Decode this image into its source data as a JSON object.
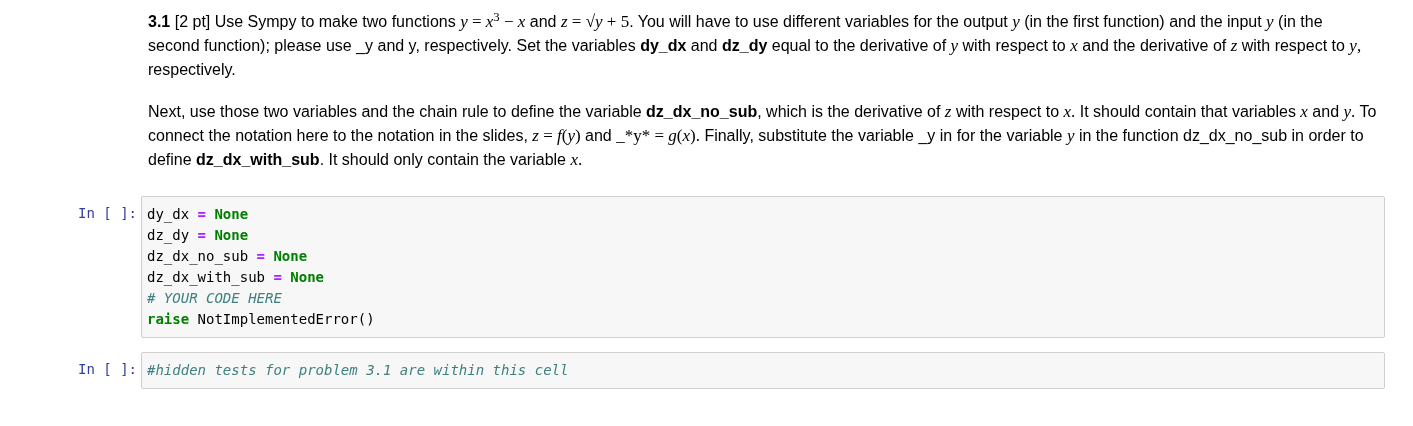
{
  "markdown_cell": {
    "paragraphs": [
      [
        {
          "kind": "bold",
          "text": "3.1"
        },
        {
          "kind": "text",
          "text": " [2 pt] Use Sympy to make two functions "
        },
        {
          "kind": "math",
          "text": "*y* = *x*$^{3}$ − *x*"
        },
        {
          "kind": "text",
          "text": " and "
        },
        {
          "kind": "math",
          "text": "*z* = √*y* + 5"
        },
        {
          "kind": "text",
          "text": ". You will have to use different variables for the output "
        },
        {
          "kind": "math",
          "text": "*y*"
        },
        {
          "kind": "text",
          "text": " (in the first function) and the input "
        },
        {
          "kind": "math",
          "text": "*y*"
        },
        {
          "kind": "text",
          "text": " (in the second function); please use _y and y, respectively. Set the variables "
        },
        {
          "kind": "bold",
          "text": "dy_dx"
        },
        {
          "kind": "text",
          "text": " and "
        },
        {
          "kind": "bold",
          "text": "dz_dy"
        },
        {
          "kind": "text",
          "text": " equal to the derivative of "
        },
        {
          "kind": "math",
          "text": "*y*"
        },
        {
          "kind": "text",
          "text": " with respect to "
        },
        {
          "kind": "math",
          "text": "*x*"
        },
        {
          "kind": "text",
          "text": " and the derivative of "
        },
        {
          "kind": "math",
          "text": "*z*"
        },
        {
          "kind": "text",
          "text": " with respect to "
        },
        {
          "kind": "math",
          "text": "*y*,"
        },
        {
          "kind": "text",
          "text": " respectively."
        }
      ],
      [
        {
          "kind": "text",
          "text": "Next, use those two variables and the chain rule to define the variable "
        },
        {
          "kind": "bold",
          "text": "dz_dx_no_sub"
        },
        {
          "kind": "text",
          "text": ", which is the derivative of "
        },
        {
          "kind": "math",
          "text": "*z*"
        },
        {
          "kind": "text",
          "text": " with respect to "
        },
        {
          "kind": "math",
          "text": "*x*."
        },
        {
          "kind": "text",
          "text": " It should contain that variables "
        },
        {
          "kind": "math",
          "text": "*x*"
        },
        {
          "kind": "text",
          "text": " and "
        },
        {
          "kind": "math",
          "text": "*y*."
        },
        {
          "kind": "text",
          "text": " To connect the notation here to the notation in the slides, "
        },
        {
          "kind": "math",
          "text": "*z* = *f*(*y*)"
        },
        {
          "kind": "text",
          "text": " and "
        },
        {
          "kind": "math",
          "text": "_*y* = *g*(*x*)."
        },
        {
          "kind": "text",
          "text": " Finally, substitute the variable _y in for the variable "
        },
        {
          "kind": "math",
          "text": "*y*"
        },
        {
          "kind": "text",
          "text": " in the function dz_dx_no_sub in order to define "
        },
        {
          "kind": "bold",
          "text": "dz_dx_with_sub"
        },
        {
          "kind": "text",
          "text": ". It should only contain the variable "
        },
        {
          "kind": "math",
          "text": "*x*."
        }
      ]
    ]
  },
  "code_cells": [
    {
      "prompt": "In [ ]:",
      "lines": [
        [
          {
            "kind": "name",
            "text": "dy_dx "
          },
          {
            "kind": "op",
            "text": "="
          },
          {
            "kind": "const",
            "text": " None"
          }
        ],
        [
          {
            "kind": "name",
            "text": "dz_dy "
          },
          {
            "kind": "op",
            "text": "="
          },
          {
            "kind": "const",
            "text": " None"
          }
        ],
        [
          {
            "kind": "name",
            "text": "dz_dx_no_sub "
          },
          {
            "kind": "op",
            "text": "="
          },
          {
            "kind": "const",
            "text": " None"
          }
        ],
        [
          {
            "kind": "name",
            "text": "dz_dx_with_sub "
          },
          {
            "kind": "op",
            "text": "="
          },
          {
            "kind": "const",
            "text": " None"
          }
        ],
        [
          {
            "kind": "comment",
            "text": "# YOUR CODE HERE"
          }
        ],
        [
          {
            "kind": "keyword",
            "text": "raise"
          },
          {
            "kind": "name",
            "text": " NotImplementedError()"
          }
        ]
      ]
    },
    {
      "prompt": "In [ ]:",
      "lines": [
        [
          {
            "kind": "comment",
            "text": "#hidden tests for problem 3.1 are within this cell"
          }
        ]
      ]
    }
  ]
}
